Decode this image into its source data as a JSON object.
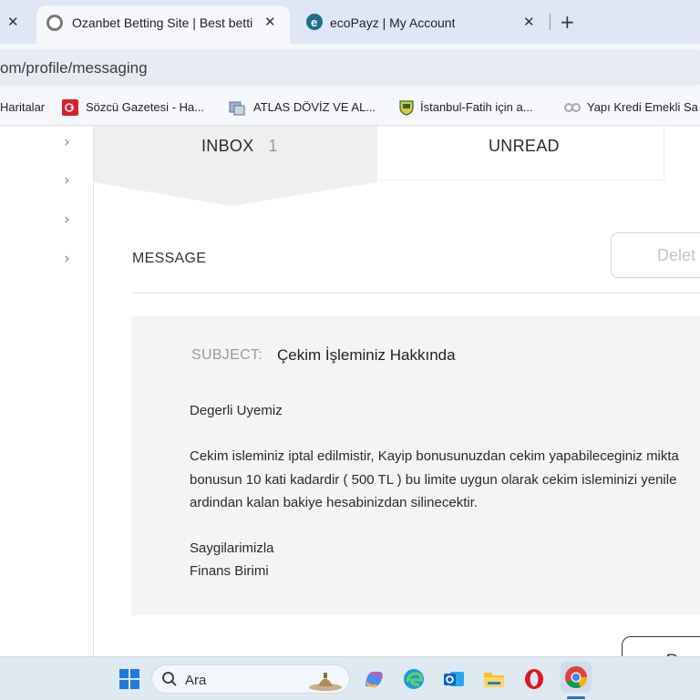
{
  "browser": {
    "tabs": [
      {
        "title": "Ozanbet Betting Site | Best betti",
        "active": true
      },
      {
        "title": "ecoPayz | My Account",
        "active": false
      }
    ],
    "close_glyph": "✕",
    "new_tab_glyph": "+",
    "url": "om/profile/messaging",
    "bookmarks": [
      {
        "label": "Haritalar",
        "icon": "maps-icon"
      },
      {
        "label": "Sözcü Gazetesi - Ha...",
        "icon": "sozcu-icon"
      },
      {
        "label": "ATLAS DÖVİZ VE AL...",
        "icon": "atlas-icon"
      },
      {
        "label": "İstanbul-Fatih için a...",
        "icon": "fatih-shield-icon"
      },
      {
        "label": "Yapı Kredi Emekli Sa",
        "icon": "yapi-kredi-icon"
      }
    ]
  },
  "page": {
    "sidebar_chevron": "›",
    "tabs": {
      "inbox": {
        "label": "INBOX",
        "count": "1"
      },
      "unread": {
        "label": "UNREAD"
      }
    },
    "message_header": "MESSAGE",
    "delete_button": "Delet",
    "message": {
      "subject_label": "SUBJECT:",
      "subject": "Çekim İşleminiz Hakkında",
      "lines": [
        "Degerli Uyemiz",
        "Cekim isleminiz iptal edilmistir, Kayip bonusunuzdan cekim yapabileceginiz mikta",
        "bonusun 10 kati kadardir ( 500 TL ) bu limite uygun olarak cekim isleminizi yenile",
        "ardindan kalan bakiye hesabinizdan silinecektir.",
        "Saygilarimizla",
        "Finans Birimi"
      ]
    },
    "bottom_button": "Re"
  },
  "taskbar": {
    "search_placeholder": "Ara",
    "apps": [
      "windows-start-icon",
      "copilot-icon",
      "edge-icon",
      "outlook-icon",
      "file-explorer-icon",
      "opera-icon",
      "chrome-icon"
    ]
  },
  "colors": {
    "tabbar_bg": "#dfe6f5",
    "toolbar_bg": "#f5f7fb",
    "inbox_tab_bg": "#efefef",
    "message_bg": "#f4f4f4",
    "taskbar_bg": "#dfe9f2"
  }
}
